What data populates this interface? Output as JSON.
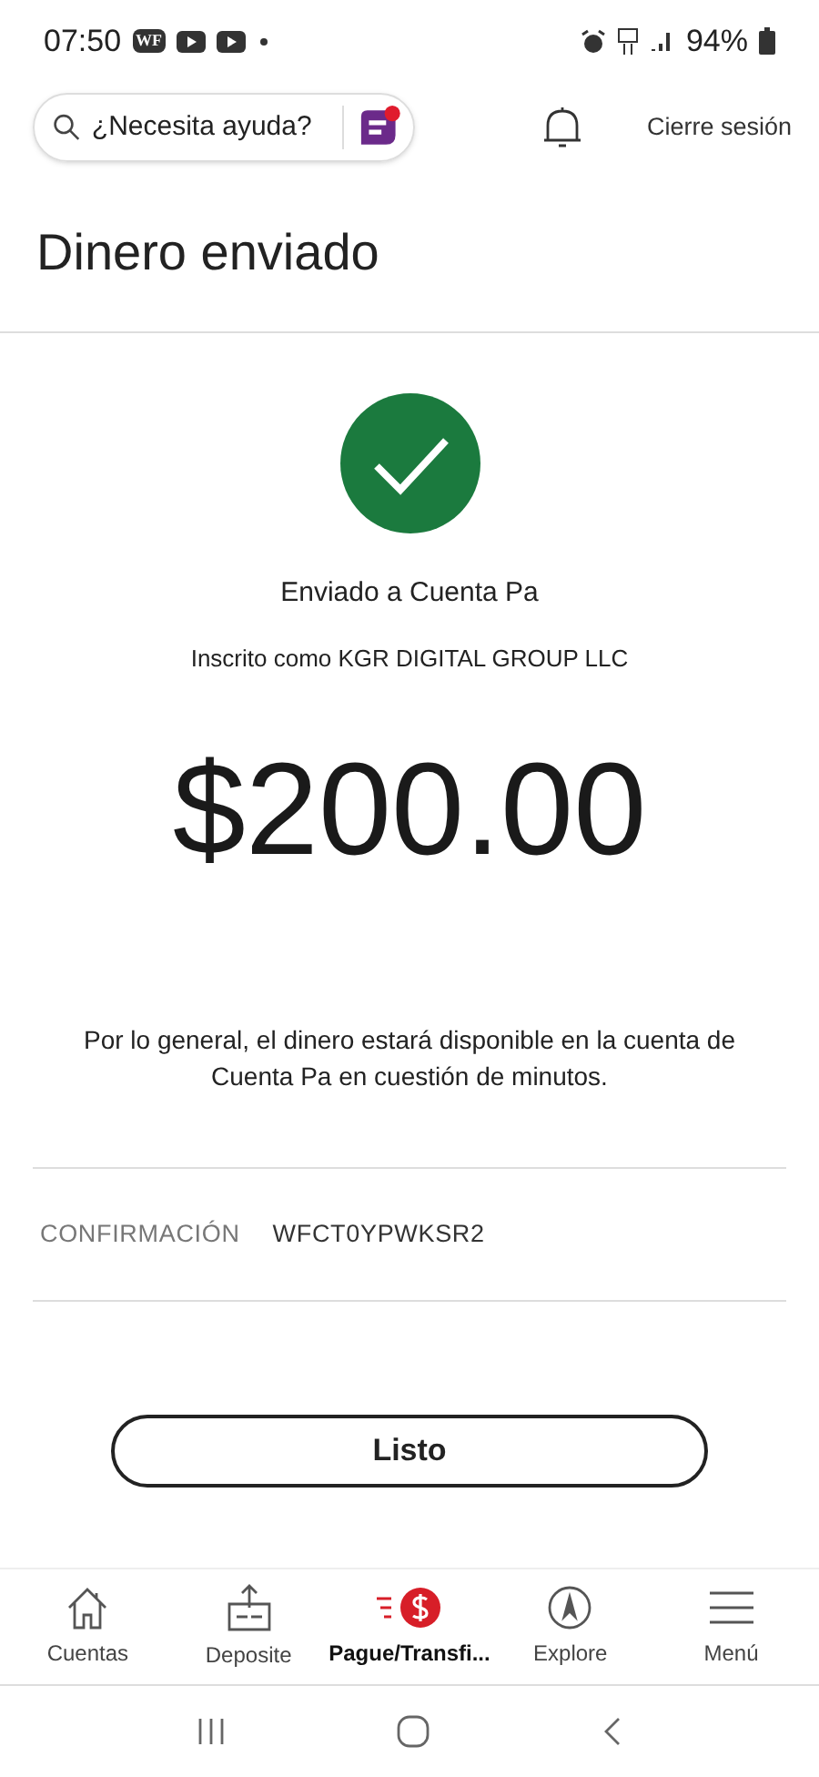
{
  "status_bar": {
    "time": "07:50",
    "app_badge": "WF",
    "battery": "94%"
  },
  "header": {
    "search": {
      "placeholder": "¿Necesita ayuda?"
    },
    "chat_unread": true,
    "logout": "Cierre sesión"
  },
  "title": "Dinero enviado",
  "recipient": "Enviado a Cuenta Pa",
  "enrolled": "Inscrito como KGR DIGITAL GROUP LLC",
  "amount": "$200.00",
  "note": "Por lo general, el dinero estará disponible en la cuenta de Cuenta Pa en cuestión de minutos.",
  "confirmation": {
    "label": "CONFIRMACIÓN",
    "value": "WFCT0YPWKSR2"
  },
  "done_button": "Listo",
  "bottom_nav": [
    {
      "kind": "home",
      "label": "Cuentas",
      "selected": false
    },
    {
      "kind": "deposit",
      "label": "Deposite",
      "selected": false
    },
    {
      "kind": "pay",
      "label": "Pague/Transfi...",
      "selected": true
    },
    {
      "kind": "explore",
      "label": "Explore",
      "selected": false
    },
    {
      "kind": "menu",
      "label": "Menú",
      "selected": false
    }
  ]
}
